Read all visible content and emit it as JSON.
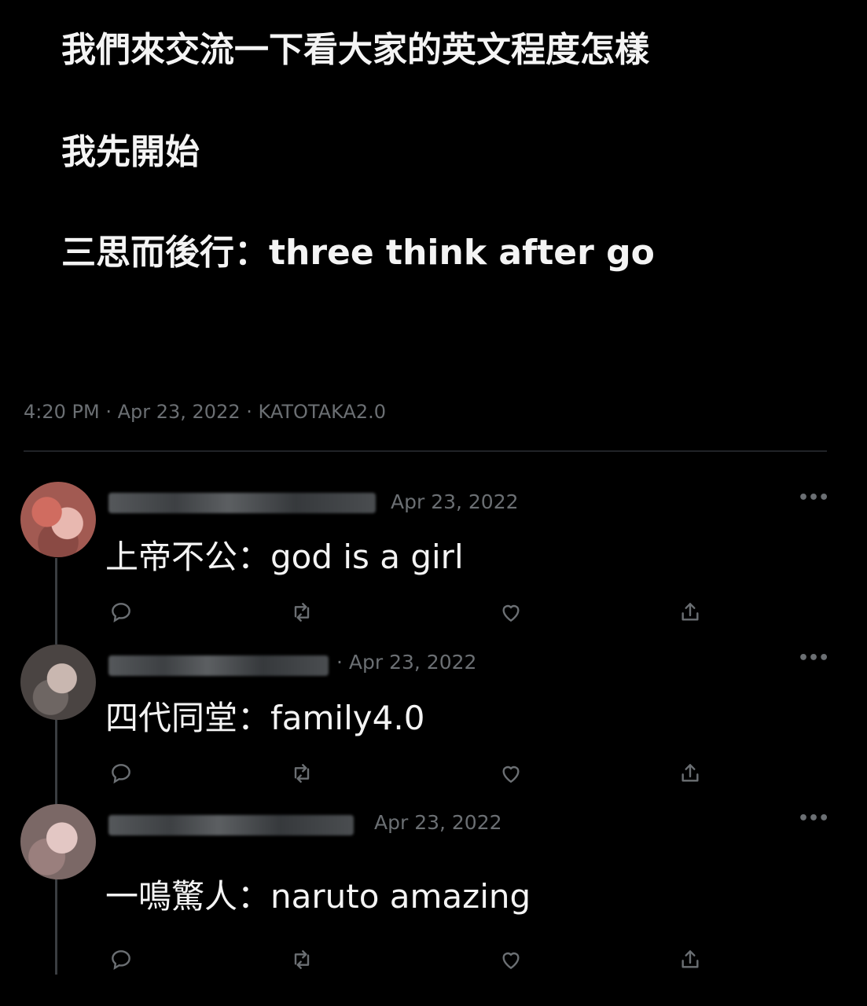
{
  "tweet": {
    "lines": [
      "我們來交流一下看大家的英文程度怎樣",
      "我先開始",
      "三思而後行：three think after go"
    ],
    "meta": "4:20 PM · Apr 23, 2022 · KATOTAKA2.0"
  },
  "replies": [
    {
      "date": "Apr 23, 2022",
      "text": "上帝不公：god is a girl"
    },
    {
      "date": "· Apr 23, 2022",
      "text": "四代同堂：family4.0"
    },
    {
      "date": "Apr 23, 2022",
      "text": "一鳴驚人：naruto amazing"
    }
  ],
  "icons": {
    "reply": "reply-icon",
    "retweet": "retweet-icon",
    "like": "heart-icon",
    "share": "share-icon",
    "more": "more-icon"
  },
  "colors": {
    "background": "#000000",
    "text": "#f4f4f4",
    "muted": "#6b6f73",
    "divider": "#202327"
  }
}
